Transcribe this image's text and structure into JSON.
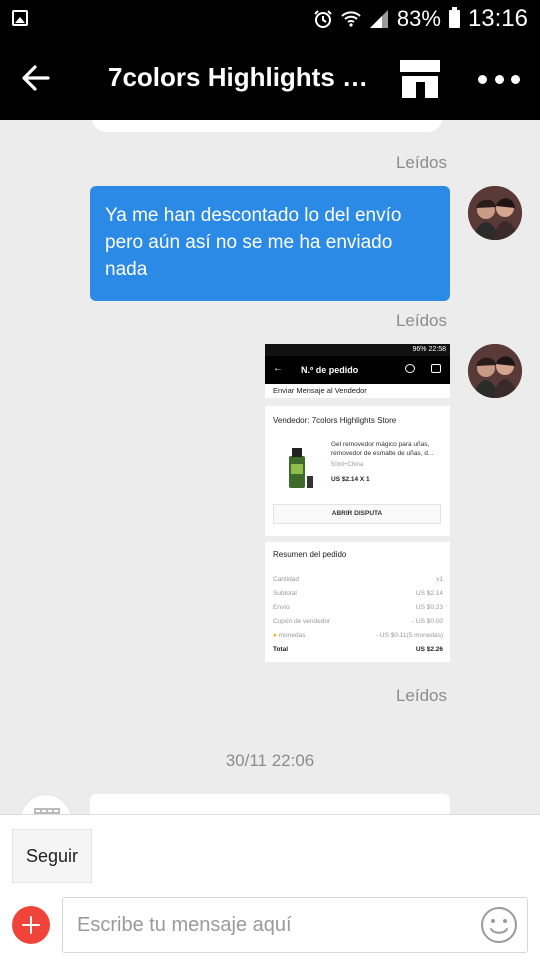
{
  "status_bar": {
    "battery": "83%",
    "time": "13:16"
  },
  "header": {
    "title": "7colors Highlights Store"
  },
  "messages": {
    "read_label_1": "Leídos",
    "read_label_2": "Leídos",
    "read_label_3": "Leídos",
    "text_message": "Ya me han descontado lo del envío pero aún así no se me ha enviado nada",
    "date_separator": "30/11 22:06"
  },
  "attachment": {
    "status_text": "96% 22:58",
    "title": "N.º de pedido",
    "link": "Enviar Mensaje al Vendedor",
    "seller": "Vendedor: 7colors Highlights Store",
    "product_name": "Gel removedor mágico para uñas, removedor de esmalte de uñas, d...",
    "product_variant": "50ml+China",
    "product_price": "US $2.14 X 1",
    "dispute_button": "ABRIR DISPUTA",
    "summary_title": "Resumen del pedido",
    "rows": [
      {
        "label": "Cantidad",
        "value": "x1"
      },
      {
        "label": "Subtotal",
        "value": "US $2.14"
      },
      {
        "label": "Envío",
        "value": "US $0.23"
      },
      {
        "label": "Cupón de vendedor",
        "value": "- US $0.00"
      },
      {
        "label": "monedas",
        "value": "- US $0.11(5 monedas)"
      },
      {
        "label": "Total",
        "value": "US $2.26"
      }
    ]
  },
  "bottom": {
    "follow_button": "Seguir",
    "input_placeholder": "Escribe tu mensaje aquí"
  },
  "colors": {
    "bubble": "#2b8ae6",
    "plus": "#f0443a"
  }
}
